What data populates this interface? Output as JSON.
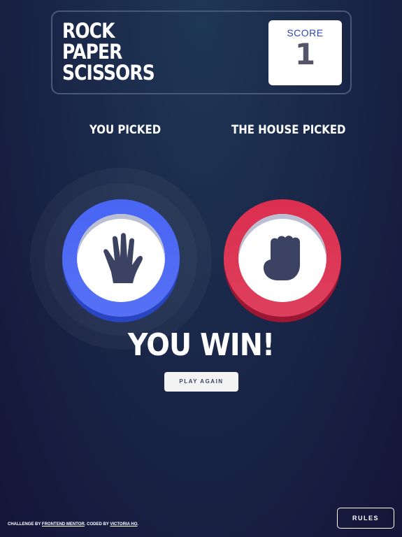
{
  "header": {
    "title_lines": [
      "ROCK",
      "PAPER",
      "SCISSORS"
    ],
    "score_label": "SCORE",
    "score_value": "1"
  },
  "picks": {
    "you_label": "YOU PICKED",
    "house_label": "THE HOUSE PICKED",
    "you_choice": "paper",
    "house_choice": "rock",
    "you_icon": "paper-hand-icon",
    "house_icon": "rock-fist-icon"
  },
  "result": {
    "text": "YOU WIN!",
    "play_again_label": "PLAY AGAIN"
  },
  "footer": {
    "challenge_prefix": "CHALLENGE BY",
    "challenge_link": "FRONTEND MENTOR",
    "coded_prefix": ". CODED BY",
    "author_link": "VICTORIA HO",
    "suffix": ".",
    "rules_label": "RULES"
  },
  "colors": {
    "paper": "#4865f4",
    "rock": "#dc2e4e",
    "score_text": "#565468",
    "background_top": "#1f3756",
    "background_bottom": "#141539"
  }
}
